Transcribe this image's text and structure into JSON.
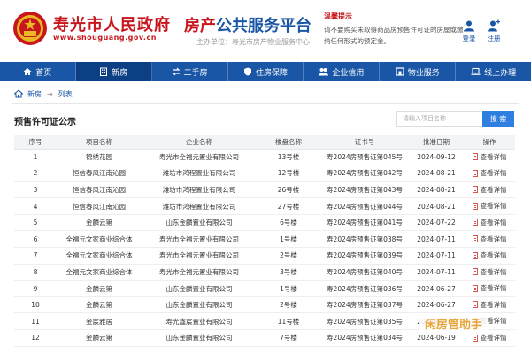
{
  "header": {
    "site_title": "寿光市人民政府",
    "site_url": "www.shouguang.gov.cn",
    "platform_title_part1": "房产",
    "platform_title_part2": "公共服务平台",
    "platform_host": "主办单位：寿光市房产物业服务中心",
    "tip_title": "温馨提示",
    "tip_text": "请不要购买未取得商品房预售许可证的房屋或缴纳任何形式的预定金。",
    "login_label": "登录",
    "register_label": "注册"
  },
  "nav": {
    "items": [
      {
        "label": "首页",
        "icon": "home-icon"
      },
      {
        "label": "新房",
        "icon": "building-icon"
      },
      {
        "label": "二手房",
        "icon": "swap-icon"
      },
      {
        "label": "住房保障",
        "icon": "shield-icon"
      },
      {
        "label": "企业信用",
        "icon": "people-icon"
      },
      {
        "label": "物业服务",
        "icon": "house-icon"
      },
      {
        "label": "线上办理",
        "icon": "laptop-icon"
      }
    ],
    "active_index": 1
  },
  "breadcrumb": {
    "items": [
      "新房",
      "列表"
    ]
  },
  "page": {
    "title": "预售许可证公示",
    "search_placeholder": "请输入项目名称",
    "search_button": "搜 索"
  },
  "table": {
    "headers": [
      "序号",
      "项目名称",
      "企业名称",
      "楼盘名称",
      "证书号",
      "批准日期",
      "操作"
    ],
    "action_label": "查看详情",
    "rows": [
      [
        "1",
        "锦绣花园",
        "寿光市全福元置业有限公司",
        "13号楼",
        "寿2024房预售证第045号",
        "2024-09-12"
      ],
      [
        "2",
        "恒信春风江南沁园",
        "潍坊市鸿程置业有限公司",
        "12号楼",
        "寿2024房预售证第042号",
        "2024-08-21"
      ],
      [
        "3",
        "恒信春风江南沁园",
        "潍坊市鸿程置业有限公司",
        "26号楼",
        "寿2024房预售证第043号",
        "2024-08-21"
      ],
      [
        "4",
        "恒信春风江南沁园",
        "潍坊市鸿程置业有限公司",
        "27号楼",
        "寿2024房预售证第044号",
        "2024-08-21"
      ],
      [
        "5",
        "金麟云第",
        "山东金麟置业有限公司",
        "6号楼",
        "寿2024房预售证第041号",
        "2024-07-22"
      ],
      [
        "6",
        "全福元文家商业综合体",
        "寿光市全福元置业有限公司",
        "1号楼",
        "寿2024房预售证第038号",
        "2024-07-11"
      ],
      [
        "7",
        "全福元文家商业综合体",
        "寿光市全福元置业有限公司",
        "2号楼",
        "寿2024房预售证第039号",
        "2024-07-11"
      ],
      [
        "8",
        "全福元文家商业综合体",
        "寿光市全福元置业有限公司",
        "3号楼",
        "寿2024房预售证第040号",
        "2024-07-11"
      ],
      [
        "9",
        "金麟云第",
        "山东金麟置业有限公司",
        "1号楼",
        "寿2024房预售证第036号",
        "2024-06-27"
      ],
      [
        "10",
        "金麟云第",
        "山东金麟置业有限公司",
        "2号楼",
        "寿2024房预售证第037号",
        "2024-06-27"
      ],
      [
        "11",
        "金宸雅居",
        "寿光鑫宸置业有限公司",
        "11号楼",
        "寿2024房预售证第035号",
        "2024-06-24"
      ],
      [
        "12",
        "金麟云第",
        "山东金麟置业有限公司",
        "7号楼",
        "寿2024房预售证第034号",
        "2024-06-19"
      ]
    ]
  },
  "watermark": {
    "text": "闲房管助手"
  },
  "colors": {
    "brand_red": "#c8161d",
    "brand_blue": "#1a56a6",
    "nav_active": "#0d3f84",
    "search_button": "#2f7fe0"
  }
}
